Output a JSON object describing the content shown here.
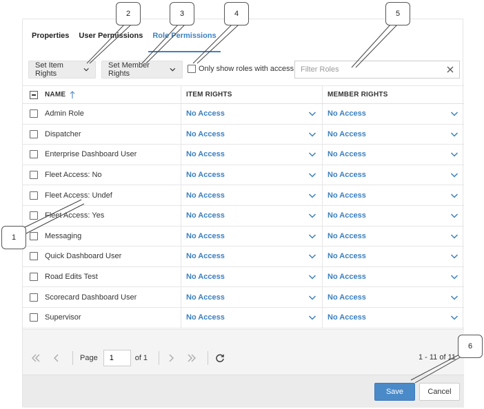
{
  "tabs": [
    {
      "label": "Properties"
    },
    {
      "label": "User Permissions"
    },
    {
      "label": "Role Permissions"
    }
  ],
  "toolbar": {
    "set_item_rights": "Set Item Rights",
    "set_member_rights": "Set Member Rights",
    "only_show_label": "Only show roles with access",
    "filter_placeholder": "Filter Roles"
  },
  "grid": {
    "headers": {
      "name": "NAME",
      "item_rights": "ITEM RIGHTS",
      "member_rights": "MEMBER RIGHTS"
    },
    "rows": [
      {
        "name": "Admin Role",
        "item": "No Access",
        "member": "No Access"
      },
      {
        "name": "Dispatcher",
        "item": "No Access",
        "member": "No Access"
      },
      {
        "name": "Enterprise Dashboard User",
        "item": "No Access",
        "member": "No Access"
      },
      {
        "name": "Fleet Access: No",
        "item": "No Access",
        "member": "No Access"
      },
      {
        "name": "Fleet Access: Undef",
        "item": "No Access",
        "member": "No Access"
      },
      {
        "name": "Fleet Access: Yes",
        "item": "No Access",
        "member": "No Access"
      },
      {
        "name": "Messaging",
        "item": "No Access",
        "member": "No Access"
      },
      {
        "name": "Quick Dashboard User",
        "item": "No Access",
        "member": "No Access"
      },
      {
        "name": "Road Edits Test",
        "item": "No Access",
        "member": "No Access"
      },
      {
        "name": "Scorecard Dashboard User",
        "item": "No Access",
        "member": "No Access"
      },
      {
        "name": "Supervisor",
        "item": "No Access",
        "member": "No Access"
      }
    ]
  },
  "pager": {
    "page_label": "Page",
    "page_value": "1",
    "of_label": "of 1",
    "range": "1 - 11 of 11"
  },
  "actions": {
    "save": "Save",
    "cancel": "Cancel"
  },
  "callouts": [
    "1",
    "2",
    "3",
    "4",
    "5",
    "6"
  ],
  "colors": {
    "accent": "#3a7fc1",
    "save_button": "#4a8ac9"
  }
}
